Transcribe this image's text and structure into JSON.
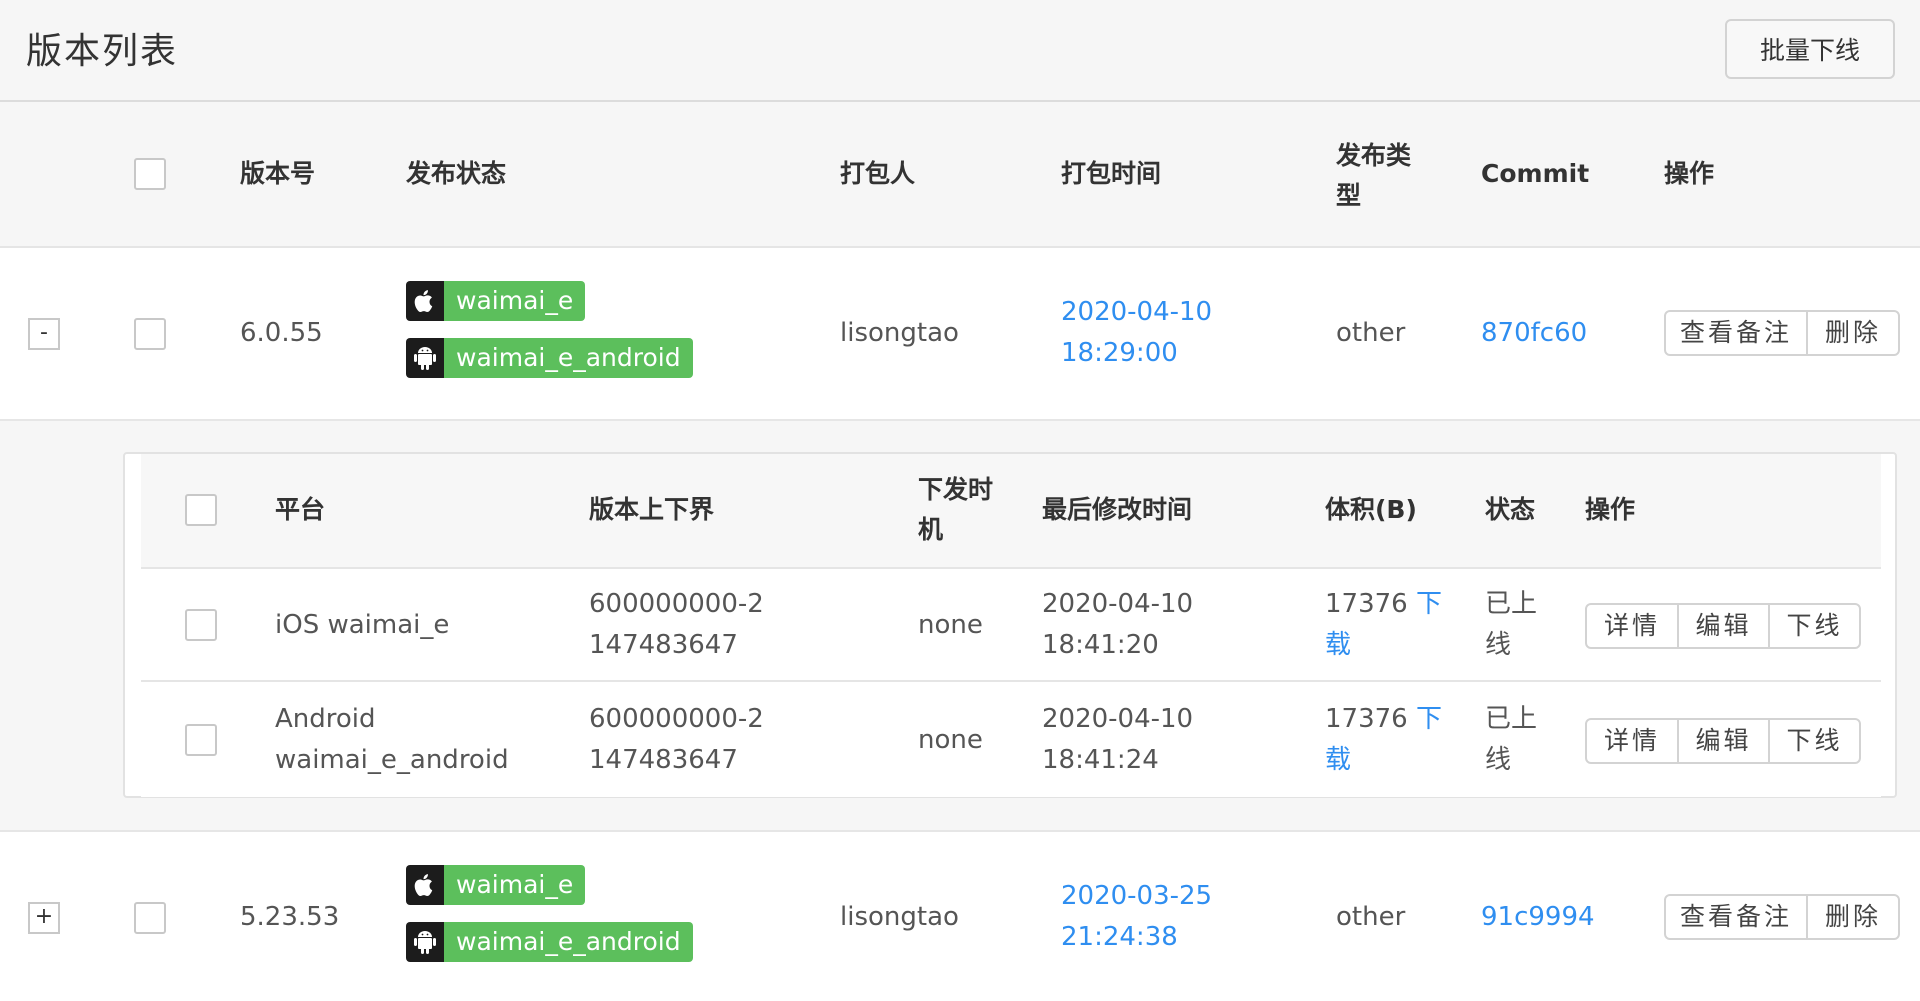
{
  "header": {
    "title": "版本列表",
    "batch_offline_label": "批量下线"
  },
  "columns": {
    "version": "版本号",
    "publish_status": "发布状态",
    "packager": "打包人",
    "pack_time": "打包时间",
    "publish_type": "发布类型",
    "commit": "Commit",
    "actions": "操作"
  },
  "rows": [
    {
      "toggle": "-",
      "version": "6.0.55",
      "packages": [
        {
          "icon": "apple-icon",
          "label": "waimai_e"
        },
        {
          "icon": "android-icon",
          "label": "waimai_e_android"
        }
      ],
      "packager": "lisongtao",
      "pack_time": "2020-04-10 18:29:00",
      "publish_type": "other",
      "commit": "870fc60",
      "view_note_label": "查看备注",
      "delete_label": "删除"
    },
    {
      "toggle": "+",
      "version": "5.23.53",
      "packages": [
        {
          "icon": "apple-icon",
          "label": "waimai_e"
        },
        {
          "icon": "android-icon",
          "label": "waimai_e_android"
        }
      ],
      "packager": "lisongtao",
      "pack_time": "2020-03-25 21:24:38",
      "publish_type": "other",
      "commit": "91c9994",
      "view_note_label": "查看备注",
      "delete_label": "删除"
    }
  ],
  "sub_columns": {
    "platform": "平台",
    "version_range": "版本上下界",
    "dispatch_timing": "下发时机",
    "last_modified": "最后修改时间",
    "size": "体积(B)",
    "status": "状态",
    "actions": "操作"
  },
  "sub_rows": [
    {
      "platform": "iOS waimai_e",
      "version_range": "600000000-2147483647",
      "dispatch_timing": "none",
      "last_modified": "2020-04-10 18:41:20",
      "size": "17376",
      "download_label": "下载",
      "status": "已上线",
      "detail_label": "详情",
      "edit_label": "编辑",
      "offline_label": "下线"
    },
    {
      "platform": "Android waimai_e_android",
      "version_range": "600000000-2147483647",
      "dispatch_timing": "none",
      "last_modified": "2020-04-10 18:41:24",
      "size": "17376",
      "download_label": "下载",
      "status": "已上线",
      "detail_label": "详情",
      "edit_label": "编辑",
      "offline_label": "下线"
    }
  ],
  "colors": {
    "link": "#2f8ef0",
    "tag_green": "#5cbf5c",
    "tag_icon_bg": "#1c1c1c"
  }
}
